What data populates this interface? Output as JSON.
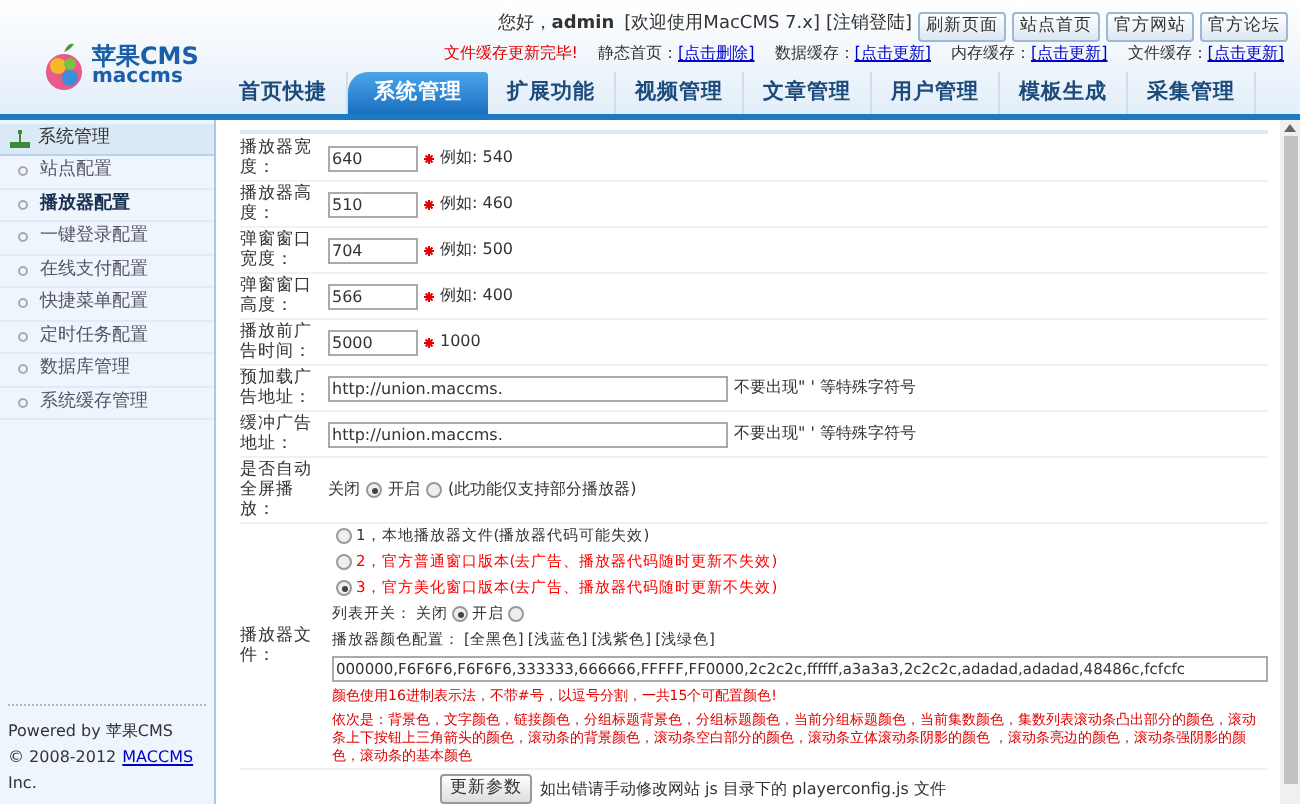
{
  "logo": {
    "title": "苹果CMS",
    "subtitle": "maccms"
  },
  "topbar": {
    "greeting": "您好，",
    "user": "admin",
    "welcome": "[欢迎使用MacCMS  7.x]",
    "logout": "[注销登陆]",
    "buttons": [
      "刷新页面",
      "站点首页",
      "官方网站",
      "官方论坛"
    ]
  },
  "cache_bar": {
    "message": "文件缓存更新完毕!",
    "items": [
      {
        "label": "静态首页：",
        "link": "[点击删除]"
      },
      {
        "label": "数据缓存：",
        "link": "[点击更新]"
      },
      {
        "label": "内存缓存：",
        "link": "[点击更新]"
      },
      {
        "label": "文件缓存：",
        "link": "[点击更新]"
      }
    ]
  },
  "tabs": [
    {
      "label": "首页快捷",
      "selected": false
    },
    {
      "label": "系统管理",
      "selected": true
    },
    {
      "label": "扩展功能",
      "selected": false
    },
    {
      "label": "视频管理",
      "selected": false
    },
    {
      "label": "文章管理",
      "selected": false
    },
    {
      "label": "用户管理",
      "selected": false
    },
    {
      "label": "模板生成",
      "selected": false
    },
    {
      "label": "采集管理",
      "selected": false
    }
  ],
  "sidebar": {
    "title": "系统管理",
    "items": [
      {
        "label": "站点配置",
        "selected": false
      },
      {
        "label": "播放器配置",
        "selected": true
      },
      {
        "label": "一键登录配置",
        "selected": false
      },
      {
        "label": "在线支付配置",
        "selected": false
      },
      {
        "label": "快捷菜单配置",
        "selected": false
      },
      {
        "label": "定时任务配置",
        "selected": false
      },
      {
        "label": "数据库管理",
        "selected": false
      },
      {
        "label": "系统缓存管理",
        "selected": false
      }
    ],
    "footer": {
      "text": "Powered by 苹果CMS",
      "copyright": "© 2008-2012",
      "link": "MACCMS",
      "suffix": "Inc."
    }
  },
  "form": {
    "rows": [
      {
        "kind": "text",
        "label": "播放器宽度：",
        "value": "640",
        "required": true,
        "hint": "例如: 540"
      },
      {
        "kind": "text",
        "label": "播放器高度：",
        "value": "510",
        "required": true,
        "hint": "例如: 460"
      },
      {
        "kind": "text",
        "label": "弹窗窗口宽度：",
        "value": "704",
        "required": true,
        "hint": "例如: 500"
      },
      {
        "kind": "text",
        "label": "弹窗窗口高度：",
        "value": "566",
        "required": true,
        "hint": "例如: 400"
      },
      {
        "kind": "text",
        "label": "播放前广告时间：",
        "value": "5000",
        "required": true,
        "hint": "1000"
      },
      {
        "kind": "url",
        "label": "预加载广告地址：",
        "value": "http://union.maccms.",
        "hint": "不要出现\" ' 等特殊字符号"
      },
      {
        "kind": "url",
        "label": "缓冲广告地址：",
        "value": "http://union.maccms.",
        "hint": "不要出现\" ' 等特殊字符号"
      },
      {
        "kind": "radio",
        "label": "是否自动全屏播放：",
        "options": [
          {
            "label": "关闭",
            "selected": true
          },
          {
            "label": "开启",
            "selected": false
          }
        ],
        "note": "(此功能仅支持部分播放器)"
      },
      {
        "kind": "player",
        "label": "播放器文件：",
        "files": [
          {
            "label": "1，本地播放器文件(播放器代码可能失效)",
            "selected": false,
            "color": "#333333"
          },
          {
            "label": "2，官方普通窗口版本(去广告、播放器代码随时更新不失效)",
            "selected": false,
            "color": "#ff0000"
          },
          {
            "label": "3，官方美化窗口版本(去广告、播放器代码随时更新不失效)",
            "selected": true,
            "color": "#ff0000"
          }
        ],
        "list_label": "列表开关：",
        "list_options": [
          {
            "label": "关闭",
            "selected": true
          },
          {
            "label": "开启",
            "selected": false
          }
        ],
        "color_label": "播放器颜色配置：",
        "presets": [
          "[全黑色]",
          "[浅蓝色]",
          "[浅紫色]",
          "[浅绿色]"
        ],
        "colors": "000000,F6F6F6,F6F6F6,333333,666666,FFFFF,FF0000,2c2c2c,ffffff,a3a3a3,2c2c2c,adadad,adadad,48486c,fcfcfc",
        "notes": [
          "颜色使用16进制表示法，不带#号，以逗号分割，一共15个可配置颜色!",
          "依次是：背景色，文字颜色，链接颜色，分组标题背景色，分组标题颜色，当前分组标题颜色，当前集数颜色，集数列表滚动条凸出部分的颜色，滚动条上下按钮上三角箭头的颜色，滚动条的背景颜色，滚动条空白部分的颜色，滚动条立体滚动条阴影的颜色 ，滚动条亮边的颜色，滚动条强阴影的颜色，滚动条的基本颜色"
        ]
      }
    ],
    "submit": "更新参数",
    "submit_note": "如出错请手动修改网站 js 目录下的 playerconfig.js 文件"
  }
}
